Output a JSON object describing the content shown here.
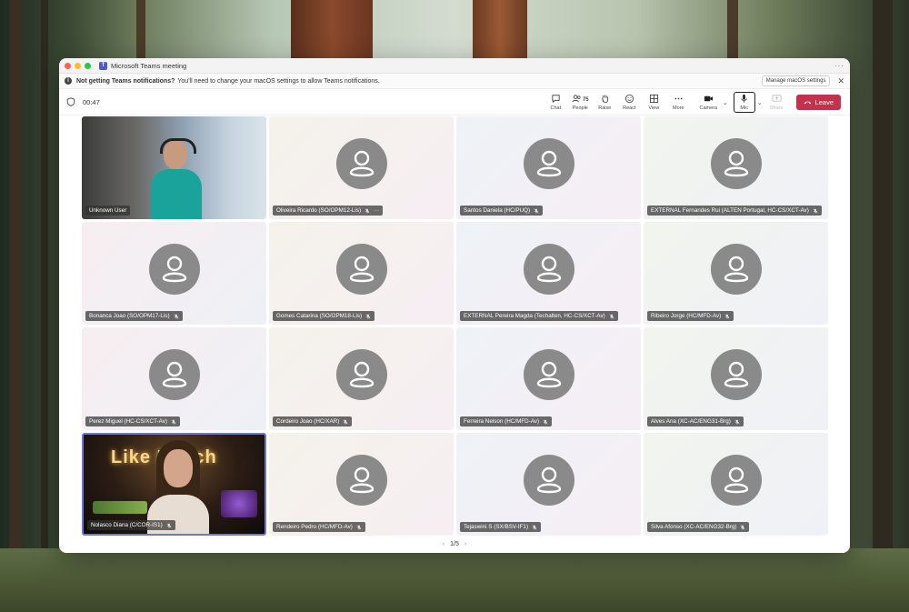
{
  "window": {
    "title": "Microsoft Teams meeting"
  },
  "banner": {
    "bold_text": "Not getting Teams notifications?",
    "text": "You'll need to change your macOS settings to allow Teams notifications.",
    "button_label": "Manage macOS settings"
  },
  "toolbar": {
    "timer": "00:47",
    "chat_label": "Chat",
    "people_label": "People",
    "people_count": "75",
    "raise_label": "Raise",
    "react_label": "React",
    "view_label": "View",
    "more_label": "More",
    "camera_label": "Camera",
    "mic_label": "Mic",
    "share_label": "Share",
    "leave_label": "Leave"
  },
  "participants": [
    {
      "name": "Unknown User"
    },
    {
      "name": "Oliveira Ricardo (SO/OPM12-Lis)"
    },
    {
      "name": "Santos Daniela (HC/PUQ)"
    },
    {
      "name": "EXTERNAL Fernandes Rui (ALTEN Portugal, HC-CS/XCT-Av)"
    },
    {
      "name": "Bonanca Joao (SO/OPM17-Lis)"
    },
    {
      "name": "Gomes Catarina (SO/OPM18-Lis)"
    },
    {
      "name": "EXTERNAL Pereira Magda (Techalten, HC-CS/XCT-Av)"
    },
    {
      "name": "Ribeiro Jorge (HC/MFD-Av)"
    },
    {
      "name": "Perez Miguel (HC-CS/XCT-Av)"
    },
    {
      "name": "Cordeiro Joao (HC/XAR)"
    },
    {
      "name": "Ferreira Nelson (HC/MFD-Av)"
    },
    {
      "name": "Alves Ana (XC-AC/ENG31-Brg)"
    },
    {
      "name": "Nolasco Diana (C/COR-IS1)"
    },
    {
      "name": "Rendeiro Pedro (HC/MFD-Av)"
    },
    {
      "name": "Tejaswini S (SX/BSV-IF1)"
    },
    {
      "name": "Silva Afonso (XC-AC/ENG32-Brg)"
    }
  ],
  "video_sign_text": "Like  Bosch",
  "pager": {
    "label": "1/5"
  }
}
